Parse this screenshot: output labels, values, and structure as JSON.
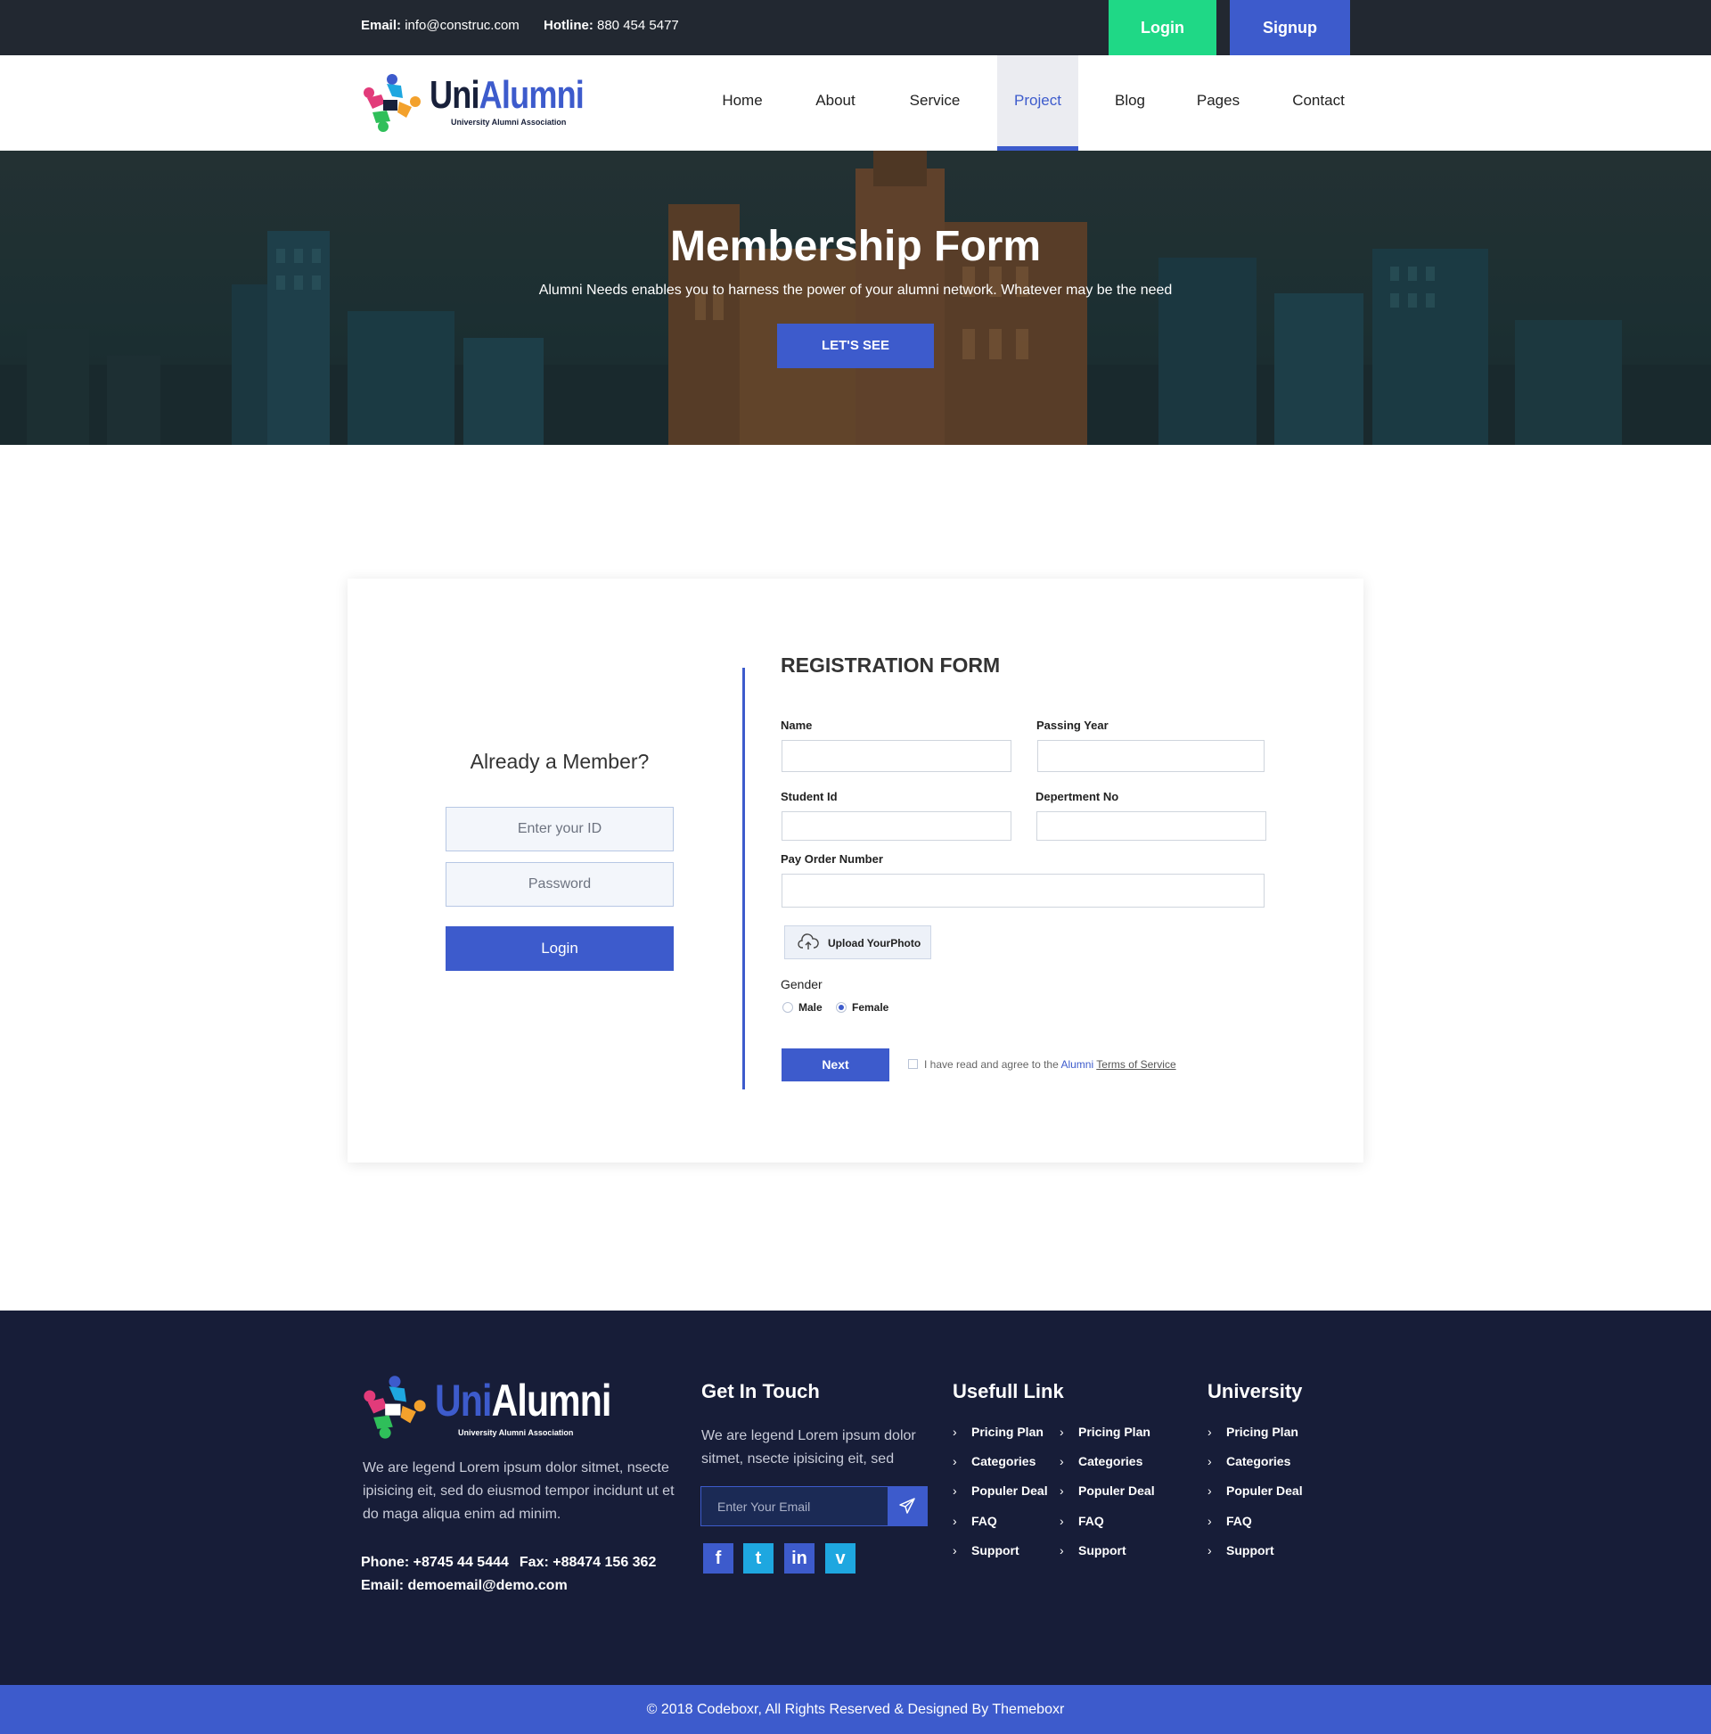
{
  "topbar": {
    "email_label": "Email:",
    "email_value": "info@construc.com",
    "hotline_label": "Hotline:",
    "hotline_value": "880 454 5477",
    "login_label": "Login",
    "signup_label": "Signup"
  },
  "brand": {
    "name_part1": "Uni",
    "name_part2": "Alumni",
    "tagline": "University Alumni Association"
  },
  "nav": {
    "items": [
      "Home",
      "About",
      "Service",
      "Project",
      "Blog",
      "Pages",
      "Contact"
    ],
    "active": "Project"
  },
  "hero": {
    "title": "Membership Form",
    "subtitle": "Alumni Needs enables you to harness the power of your alumni network. Whatever may be the need",
    "cta_label": "LET'S SEE"
  },
  "member": {
    "title": "Already a Member?",
    "id_placeholder": "Enter your ID",
    "password_placeholder": "Password",
    "login_label": "Login"
  },
  "registration": {
    "title": "REGISTRATION FORM",
    "name_label": "Name",
    "passing_year_label": "Passing Year",
    "student_id_label": "Student Id",
    "department_label": "Depertment No",
    "pay_order_label": "Pay Order Number",
    "upload_label": "Upload YourPhoto",
    "gender_label": "Gender",
    "gender_options": [
      "Male",
      "Female"
    ],
    "gender_selected": "Female",
    "next_label": "Next",
    "agree_text": "I have read and agree to the",
    "agree_brand": "Alumni",
    "terms_label": "Terms of Service",
    "agree_checked": false
  },
  "footer": {
    "about": "We are legend Lorem ipsum dolor sitmet, nsecte ipisicing eit, sed do eiusmod tempor incidunt ut et do maga aliqua enim ad minim.",
    "phone": "Phone: +8745 44 5444",
    "fax": "Fax: +88474 156 362",
    "email": "Email: demoemail@demo.com",
    "touch_title": "Get In Touch",
    "touch_text": "We are legend Lorem ipsum dolor sitmet, nsecte ipisicing eit, sed",
    "email_placeholder": "Enter Your Email",
    "social": [
      "facebook-icon",
      "twitter-icon",
      "linkedin-icon",
      "vimeo-icon"
    ],
    "links_title": "Usefull Link",
    "links_col1": [
      "Pricing Plan",
      "Categories",
      "Populer Deal",
      "FAQ",
      "Support"
    ],
    "links_col2": [
      "Pricing Plan",
      "Categories",
      "Populer Deal",
      "FAQ",
      "Support"
    ],
    "university_title": "University",
    "university_links": [
      "Pricing Plan",
      "Categories",
      "Populer Deal",
      "FAQ",
      "Support"
    ]
  },
  "copyright": "© 2018 Codeboxr, All Rights Reserved & Designed By Themeboxr",
  "colors": {
    "brand_blue": "#3d5bcc",
    "green": "#1fd886",
    "dark": "#222831",
    "footer_bg": "#171d38"
  }
}
